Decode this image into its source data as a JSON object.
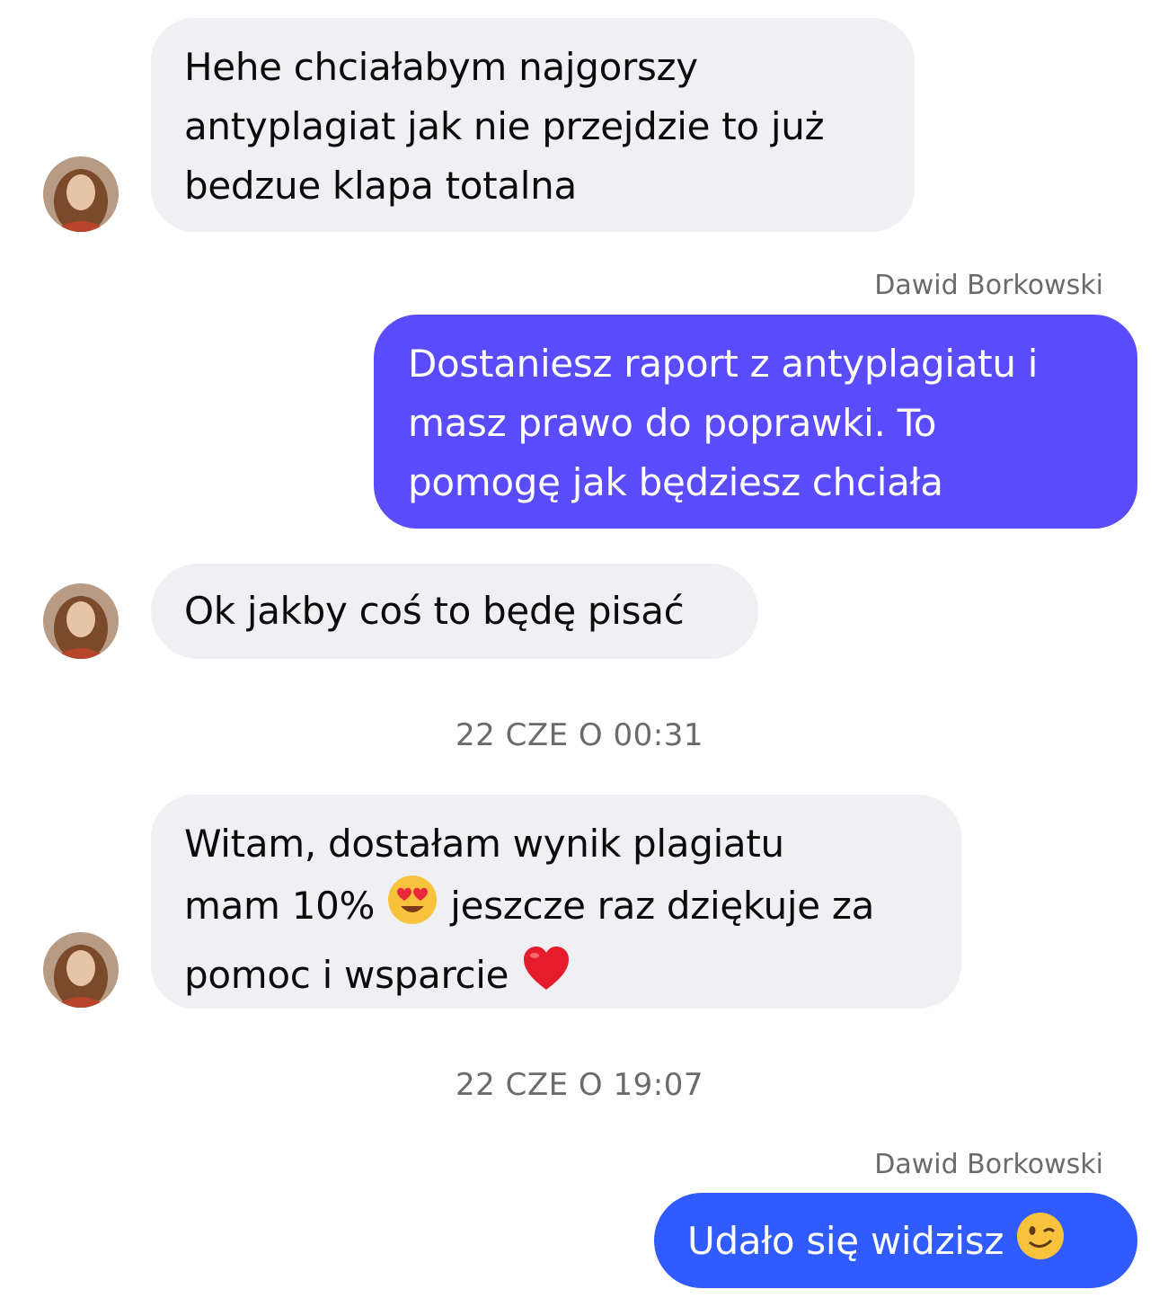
{
  "messages": [
    {
      "id": 1,
      "from": "other",
      "lines": [
        "Hehe chciałabym najgorszy",
        "antyplagiat jak nie przejdzie to już",
        "bedzue klapa totalna"
      ]
    },
    {
      "id": 2,
      "from": "me",
      "sender": "Dawid Borkowski",
      "lines": [
        "Dostaniesz raport z antyplagiatu i",
        "masz prawo do poprawki. To",
        "pomogę jak będziesz chciała"
      ]
    },
    {
      "id": 3,
      "from": "other",
      "lines": [
        "Ok jakby coś to będę pisać"
      ]
    },
    {
      "id": 4,
      "from": "other",
      "line1": "Witam, dostałam wynik plagiatu",
      "line2_a": "mam 10%",
      "line2_emoji": "heart-eyes-emoji",
      "line2_b": "jeszcze raz dziękuje za",
      "line3": "pomoc i wsparcie",
      "line3_emoji": "red-heart-emoji"
    },
    {
      "id": 5,
      "from": "me",
      "sender": "Dawid Borkowski",
      "text": "Udało się widzisz",
      "emoji": "winking-face-emoji"
    }
  ],
  "timestamps": [
    "22 CZE O 00:31",
    "22 CZE O 19:07"
  ],
  "colors": {
    "incoming_bubble": "#f0f0f4",
    "outgoing_bubble_purple": "#5b4cfb",
    "outgoing_bubble_blue": "#2f5bff",
    "secondary_text": "#6a6a6f"
  }
}
